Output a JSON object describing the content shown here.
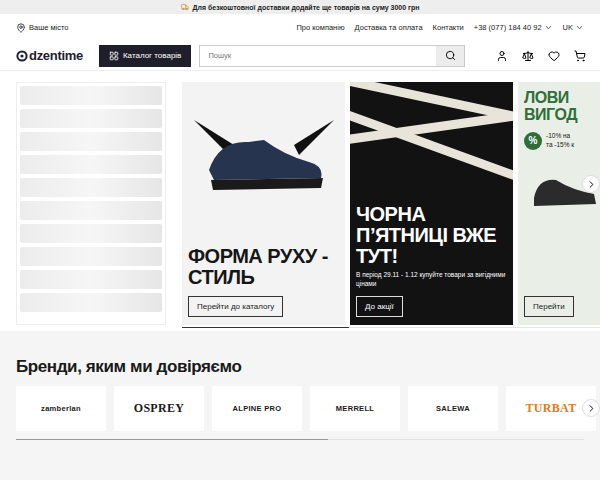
{
  "announcement": {
    "text": "Для безкоштовної доставки додайте ще товарів на суму 3000 грн"
  },
  "topbar": {
    "city": "Ваше місто",
    "links": [
      "Про компанію",
      "Доставка та оплата",
      "Контакти"
    ],
    "phone": "+38 (077) 184 40 92",
    "language": "UK"
  },
  "header": {
    "logo": "dzentime",
    "catalog_button": "Каталог товарів",
    "search": {
      "placeholder": "Пошук"
    }
  },
  "sidebar": {
    "loading": true,
    "placeholder_rows": 10
  },
  "banners": [
    {
      "kind": "light",
      "title": "ФОРМА РУХУ - СТИЛЬ",
      "text": [],
      "badge": "",
      "button": "Перейти до каталогу"
    },
    {
      "kind": "dark",
      "title": "ЧОРНА П’ЯТНИЦІ ВЖЕ ТУТ!",
      "text": [
        "В період 29.11 - 1.12 купуйте товари за вигідними цінами"
      ],
      "badge": "",
      "button": "До акції"
    },
    {
      "kind": "green",
      "title": "ЛОВИ ВИГОД",
      "text": [
        "-10% на",
        "та -15% к"
      ],
      "badge": "%",
      "button": "Перейти"
    }
  ],
  "carousel": {
    "level": 0.4
  },
  "brands": {
    "title": "Бренди, яким ми довіряємо",
    "level": 0.55,
    "items": [
      {
        "name": "zamberlan",
        "kind": "sans",
        "color": "#1a1a1a"
      },
      {
        "name": "OSPREY",
        "kind": "serif",
        "color": "#1a1a1a"
      },
      {
        "name": "ALPINE PRO",
        "kind": "sans",
        "color": "#1a1a1a"
      },
      {
        "name": "MERRELL",
        "kind": "sans",
        "color": "#1a1a1a"
      },
      {
        "name": "SALEWA",
        "kind": "sans",
        "color": "#1a1a1a"
      },
      {
        "name": "TURBAT",
        "kind": "serif",
        "color": "#e07b1a"
      }
    ]
  }
}
